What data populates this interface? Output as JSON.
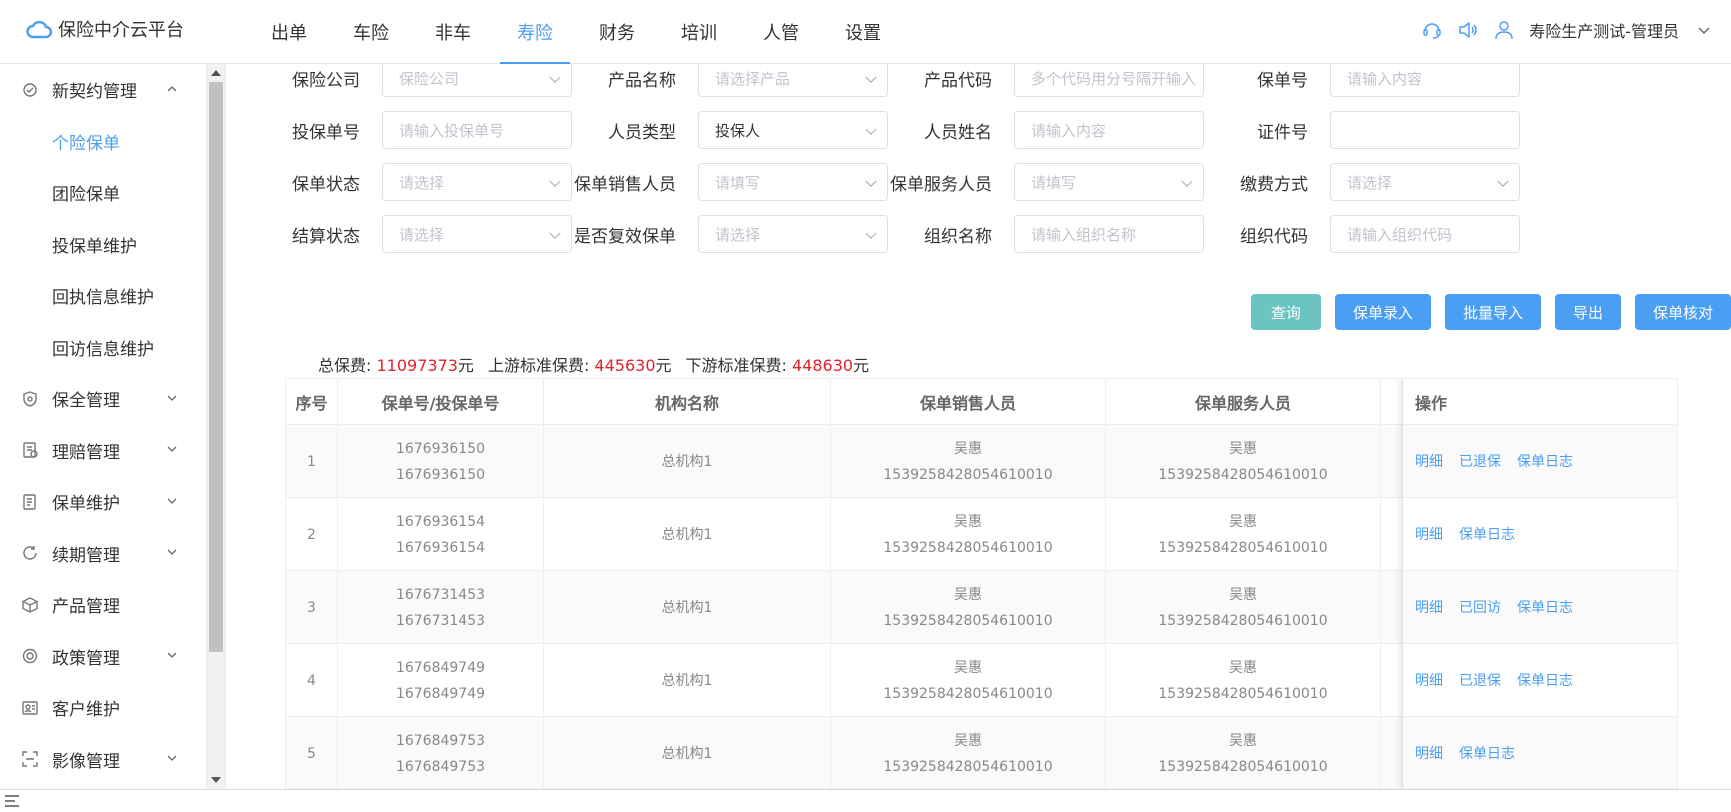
{
  "app": {
    "title": "保险中介云平台",
    "user": "寿险生产测试-管理员"
  },
  "nav": [
    {
      "label": "出单"
    },
    {
      "label": "车险"
    },
    {
      "label": "非车"
    },
    {
      "label": "寿险",
      "active": true
    },
    {
      "label": "财务"
    },
    {
      "label": "培训"
    },
    {
      "label": "人管"
    },
    {
      "label": "设置"
    }
  ],
  "sidebar": {
    "group_open": "新契约管理",
    "sub_items": [
      "个险保单",
      "团险保单",
      "投保单维护",
      "回执信息维护",
      "回访信息维护"
    ],
    "groups": [
      {
        "label": "保全管理",
        "icon": "shield-icon",
        "chevron": true
      },
      {
        "label": "理赔管理",
        "icon": "claim-icon",
        "chevron": true
      },
      {
        "label": "保单维护",
        "icon": "document-icon",
        "chevron": true
      },
      {
        "label": "续期管理",
        "icon": "renew-icon",
        "chevron": true
      },
      {
        "label": "产品管理",
        "icon": "box-icon",
        "chevron": false
      },
      {
        "label": "政策管理",
        "icon": "policy-icon",
        "chevron": true
      },
      {
        "label": "客户维护",
        "icon": "customer-icon",
        "chevron": false
      },
      {
        "label": "影像管理",
        "icon": "scan-icon",
        "chevron": true
      }
    ]
  },
  "filters": {
    "row1": [
      {
        "label": "保险公司",
        "placeholder": "保险公司",
        "dropdown": true
      },
      {
        "label": "产品名称",
        "placeholder": "请选择产品",
        "dropdown": true
      },
      {
        "label": "产品代码",
        "placeholder": "多个代码用分号隔开输入",
        "dropdown": false
      },
      {
        "label": "保单号",
        "placeholder": "请输入内容",
        "dropdown": false
      }
    ],
    "row2": [
      {
        "label": "投保单号",
        "placeholder": "请输入投保单号",
        "dropdown": false
      },
      {
        "label": "人员类型",
        "value": "投保人",
        "dropdown": true
      },
      {
        "label": "人员姓名",
        "placeholder": "请输入内容",
        "dropdown": false
      },
      {
        "label": "证件号",
        "placeholder": "",
        "dropdown": false
      }
    ],
    "row3": [
      {
        "label": "保单状态",
        "placeholder": "请选择",
        "dropdown": true
      },
      {
        "label": "保单销售人员",
        "placeholder": "请填写",
        "dropdown": true
      },
      {
        "label": "保单服务人员",
        "placeholder": "请填写",
        "dropdown": true
      },
      {
        "label": "缴费方式",
        "placeholder": "请选择",
        "dropdown": true
      }
    ],
    "row4": [
      {
        "label": "结算状态",
        "placeholder": "请选择",
        "dropdown": true
      },
      {
        "label": "是否复效保单",
        "placeholder": "请选择",
        "dropdown": true
      },
      {
        "label": "组织名称",
        "placeholder": "请输入组织名称",
        "dropdown": false
      },
      {
        "label": "组织代码",
        "placeholder": "请输入组织代码",
        "dropdown": false
      }
    ]
  },
  "buttons": {
    "search": "查询",
    "entry": "保单录入",
    "batch_import": "批量导入",
    "export": "导出",
    "verify": "保单核对"
  },
  "summary": {
    "total_label": "总保费: ",
    "total_value": "11097373",
    "unit": "元",
    "upstream_label": "上游标准保费: ",
    "upstream_value": "445630",
    "downstream_label": "下游标准保费: ",
    "downstream_value": "448630"
  },
  "table": {
    "headers": {
      "seq": "序号",
      "policy": "保单号/投保单号",
      "org": "机构名称",
      "sales": "保单销售人员",
      "service": "保单服务人员",
      "ops": "操作"
    },
    "rows": [
      {
        "seq": "1",
        "policy_no": "1676936150",
        "app_no": "1676936150",
        "org": "总机构1",
        "sales_name": "吴惠",
        "sales_id": "1539258428054610010",
        "service_name": "吴惠",
        "service_id": "1539258428054610010",
        "ops": [
          "明细",
          "已退保",
          "保单日志"
        ]
      },
      {
        "seq": "2",
        "policy_no": "1676936154",
        "app_no": "1676936154",
        "org": "总机构1",
        "sales_name": "吴惠",
        "sales_id": "1539258428054610010",
        "service_name": "吴惠",
        "service_id": "1539258428054610010",
        "ops": [
          "明细",
          "保单日志"
        ]
      },
      {
        "seq": "3",
        "policy_no": "1676731453",
        "app_no": "1676731453",
        "org": "总机构1",
        "sales_name": "吴惠",
        "sales_id": "1539258428054610010",
        "service_name": "吴惠",
        "service_id": "1539258428054610010",
        "ops": [
          "明细",
          "已回访",
          "保单日志"
        ]
      },
      {
        "seq": "4",
        "policy_no": "1676849749",
        "app_no": "1676849749",
        "org": "总机构1",
        "sales_name": "吴惠",
        "sales_id": "1539258428054610010",
        "service_name": "吴惠",
        "service_id": "1539258428054610010",
        "ops": [
          "明细",
          "已退保",
          "保单日志"
        ]
      },
      {
        "seq": "5",
        "policy_no": "1676849753",
        "app_no": "1676849753",
        "org": "总机构1",
        "sales_name": "吴惠",
        "sales_id": "1539258428054610010",
        "service_name": "吴惠",
        "service_id": "1539258428054610010",
        "ops": [
          "明细",
          "保单日志"
        ]
      }
    ]
  },
  "colors": {
    "accent": "#4a9ff5",
    "search_button": "#6bc4c0",
    "highlight_red": "#e0242c"
  }
}
